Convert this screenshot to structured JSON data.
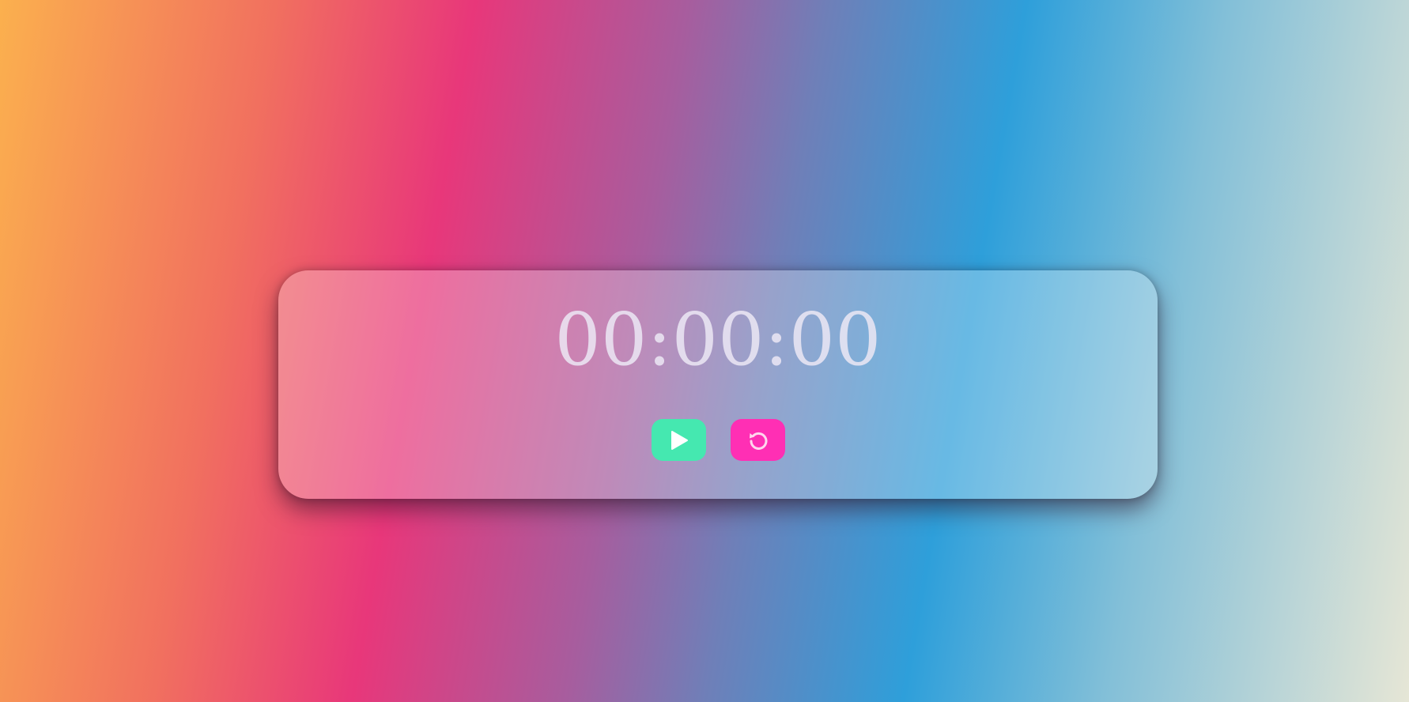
{
  "timer": {
    "display": "00:00:00"
  },
  "controls": {
    "start_icon": "play-icon",
    "reset_icon": "reset-icon"
  },
  "colors": {
    "start_button": "#45e8b0",
    "reset_button": "#ff2fb4"
  }
}
